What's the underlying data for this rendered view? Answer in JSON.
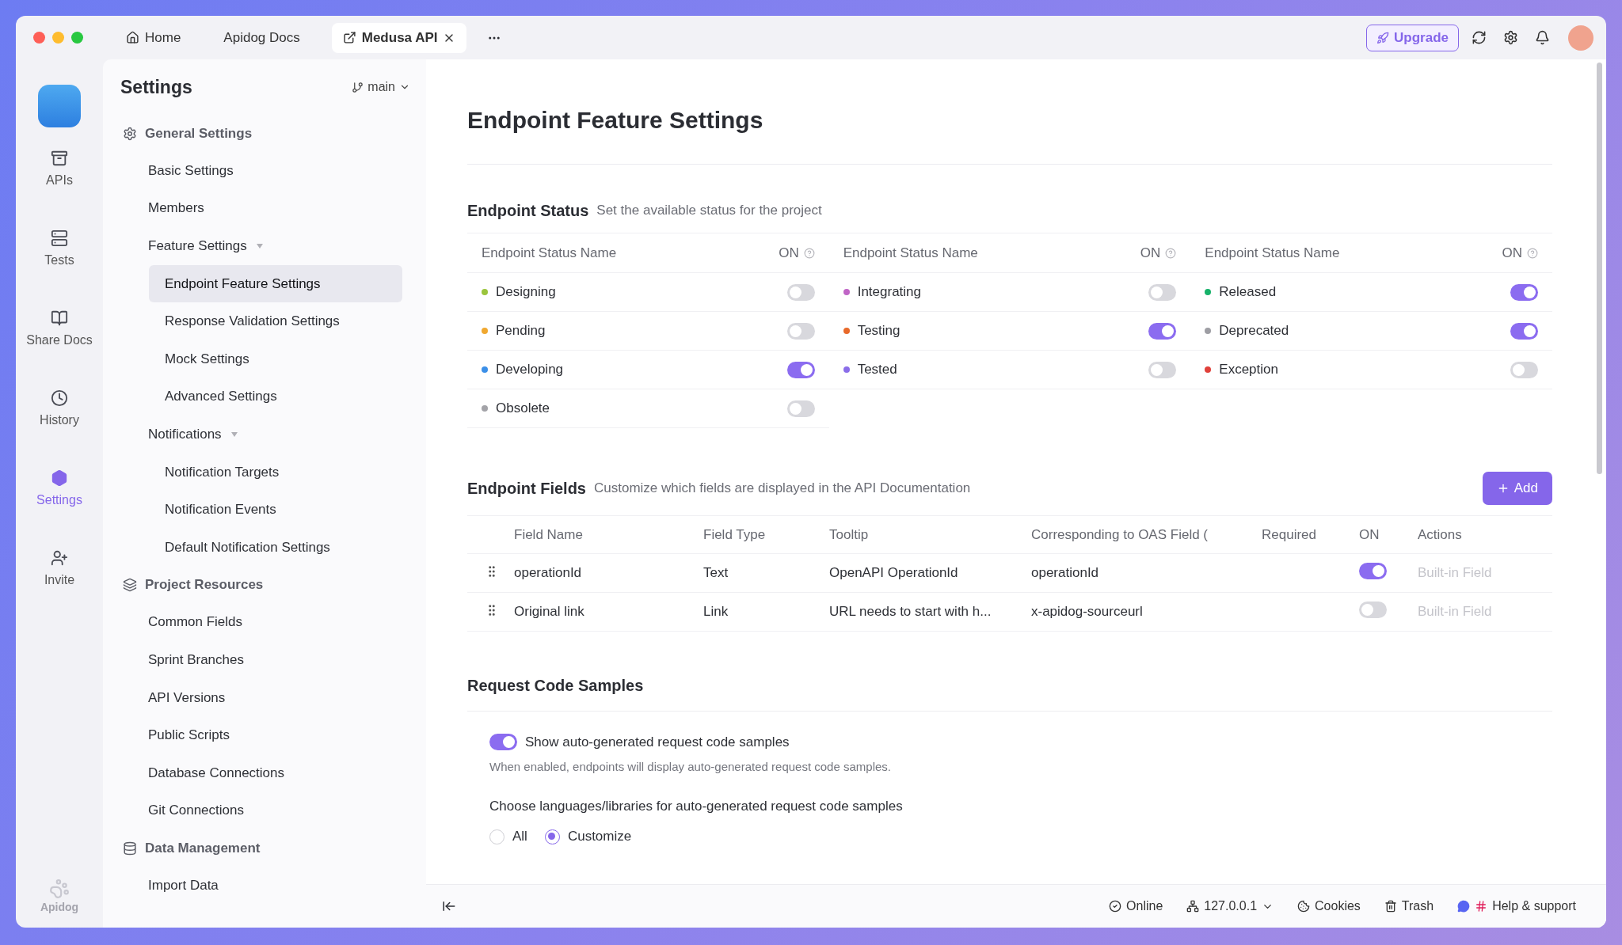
{
  "tabs": [
    {
      "kind": "home",
      "label": "Home",
      "selected": false
    },
    {
      "kind": "plain",
      "label": "Apidog Docs",
      "selected": false
    },
    {
      "kind": "project",
      "label": "Medusa API",
      "selected": true
    }
  ],
  "toolbar": {
    "upgrade_button": "Upgrade"
  },
  "rail": {
    "items": [
      {
        "kind": "apis",
        "label": "APIs",
        "selected": false
      },
      {
        "kind": "tests",
        "label": "Tests",
        "selected": false
      },
      {
        "kind": "docs",
        "label": "Share Docs",
        "selected": false
      },
      {
        "kind": "history",
        "label": "History",
        "selected": false
      },
      {
        "kind": "settings",
        "label": "Settings",
        "selected": true
      },
      {
        "kind": "invite",
        "label": "Invite",
        "selected": false
      }
    ],
    "brand": "Apidog"
  },
  "sidebar": {
    "title": "Settings",
    "branch": "main",
    "groups": [
      {
        "kind": "gear",
        "label": "General Settings",
        "children": [
          {
            "label": "Basic Settings",
            "selected": false
          },
          {
            "label": "Members",
            "selected": false
          },
          {
            "label": "Feature Settings",
            "selected": false,
            "expanded": true,
            "children": [
              {
                "label": "Endpoint Feature Settings",
                "selected": true
              },
              {
                "label": "Response Validation Settings",
                "selected": false
              },
              {
                "label": "Mock Settings",
                "selected": false
              },
              {
                "label": "Advanced Settings",
                "selected": false
              }
            ]
          },
          {
            "label": "Notifications",
            "selected": false,
            "expanded": true,
            "children": [
              {
                "label": "Notification Targets",
                "selected": false
              },
              {
                "label": "Notification Events",
                "selected": false
              },
              {
                "label": "Default Notification Settings",
                "selected": false
              }
            ]
          }
        ]
      },
      {
        "kind": "layers",
        "label": "Project Resources",
        "children": [
          {
            "label": "Common Fields",
            "selected": false
          },
          {
            "label": "Sprint Branches",
            "selected": false
          },
          {
            "label": "API Versions",
            "selected": false
          },
          {
            "label": "Public Scripts",
            "selected": false
          },
          {
            "label": "Database Connections",
            "selected": false
          },
          {
            "label": "Git Connections",
            "selected": false
          }
        ]
      },
      {
        "kind": "database",
        "label": "Data Management",
        "children": [
          {
            "label": "Import Data",
            "selected": false
          }
        ]
      }
    ]
  },
  "main": {
    "title": "Endpoint Feature Settings",
    "endpoint_status": {
      "title": "Endpoint Status",
      "description": "Set the available status for the project",
      "columns": [
        {
          "header_name": "Endpoint Status Name",
          "header_on": "ON",
          "rows": [
            {
              "name": "Designing",
              "color": "#9bc53d",
              "on": false
            },
            {
              "name": "Pending",
              "color": "#f0a830",
              "on": false
            },
            {
              "name": "Developing",
              "color": "#3b8fe8",
              "on": true
            },
            {
              "name": "Obsolete",
              "color": "#a3a3a8",
              "on": false
            }
          ]
        },
        {
          "header_name": "Endpoint Status Name",
          "header_on": "ON",
          "rows": [
            {
              "name": "Integrating",
              "color": "#c065c6",
              "on": false
            },
            {
              "name": "Testing",
              "color": "#e8692a",
              "on": true
            },
            {
              "name": "Tested",
              "color": "#8a6de9",
              "on": false
            }
          ]
        },
        {
          "header_name": "Endpoint Status Name",
          "header_on": "ON",
          "rows": [
            {
              "name": "Released",
              "color": "#17b26a",
              "on": true
            },
            {
              "name": "Deprecated",
              "color": "#9e9ea4",
              "on": true
            },
            {
              "name": "Exception",
              "color": "#e0403a",
              "on": false
            }
          ]
        }
      ]
    },
    "endpoint_fields": {
      "title": "Endpoint Fields",
      "description": "Customize which fields are displayed in the API Documentation",
      "add_button": "Add",
      "columns": [
        "Field Name",
        "Field Type",
        "Tooltip",
        "Corresponding to OAS Field (",
        "Required",
        "ON",
        "Actions"
      ],
      "rows": [
        {
          "field_name": "operationId",
          "field_type": "Text",
          "tooltip": "OpenAPI OperationId",
          "oas_field": "operationId",
          "on": true,
          "action": "Built-in Field"
        },
        {
          "field_name": "Original link",
          "field_type": "Link",
          "tooltip": "URL needs to start with h...",
          "oas_field": "x-apidog-sourceurl",
          "on": false,
          "action": "Built-in Field"
        }
      ]
    },
    "request_code_samples": {
      "title": "Request Code Samples",
      "toggle": {
        "label": "Show auto-generated request code samples",
        "on": true
      },
      "hint": "When enabled, endpoints will display auto-generated request code samples.",
      "choose_label": "Choose languages/libraries for auto-generated request code samples",
      "options": [
        {
          "label": "All",
          "selected": false
        },
        {
          "label": "Customize",
          "selected": true
        }
      ]
    }
  },
  "status_bar": {
    "items": [
      {
        "kind": "online",
        "label": "Online",
        "dropdown": false
      },
      {
        "kind": "server",
        "label": "127.0.0.1",
        "dropdown": true
      },
      {
        "kind": "cookies",
        "label": "Cookies",
        "dropdown": false
      },
      {
        "kind": "trash",
        "label": "Trash",
        "dropdown": false
      },
      {
        "kind": "help",
        "label": "Help & support",
        "dropdown": false
      }
    ]
  }
}
